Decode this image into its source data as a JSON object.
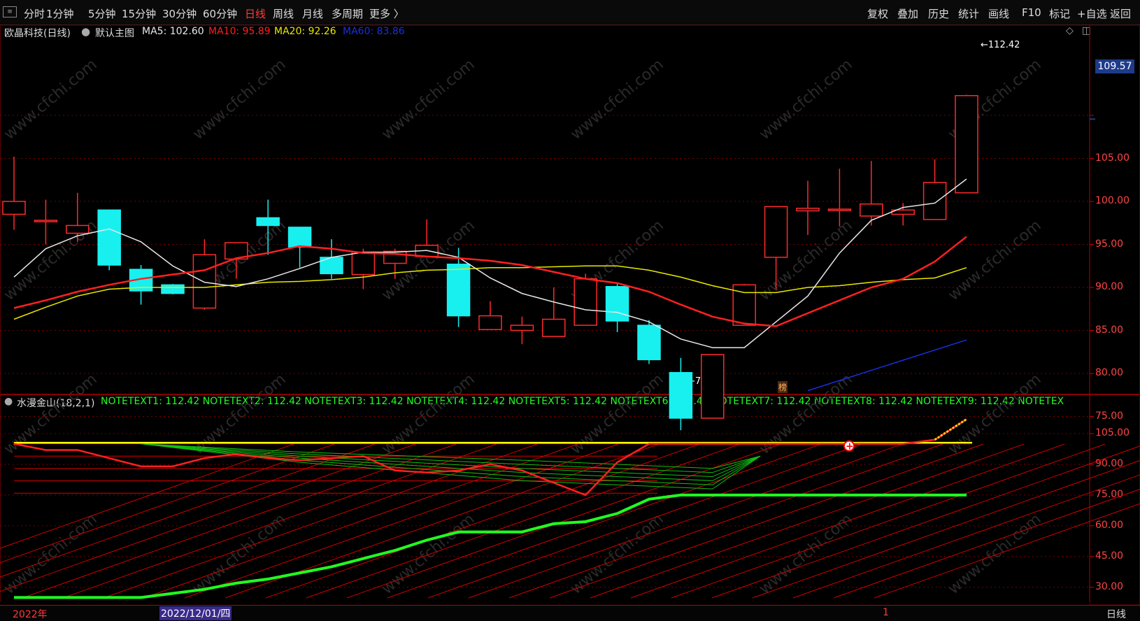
{
  "toolbar": {
    "periods": [
      "分时",
      "1分钟",
      "5分钟",
      "15分钟",
      "30分钟",
      "60分钟",
      "日线",
      "周线",
      "月线",
      "多周期",
      "更多 〉"
    ],
    "active_period": "日线",
    "right_buttons": [
      "复权",
      "叠加",
      "历史",
      "统计",
      "画线",
      "F10",
      "标记",
      "+自选",
      "返回"
    ]
  },
  "main_header": {
    "stock": "欧晶科技(日线)",
    "template": "默认主图",
    "ma5": "MA5: 102.60",
    "ma10": "MA10: 95.89",
    "ma20": "MA20: 92.26",
    "ma60": "MA60: 83.86"
  },
  "colors": {
    "ma5": "#e8e8e8",
    "ma10": "#ff2020",
    "ma20": "#e8e800",
    "ma60": "#1a2fe0",
    "up": "#ff2a2a",
    "down": "#18f0f0",
    "grid": "#7a0000",
    "green": "#20ff20"
  },
  "price_axis": {
    "labels": [
      "105.00",
      "100.00",
      "95.00",
      "90.00",
      "85.00",
      "80.00",
      "75.00"
    ],
    "current": "109.57"
  },
  "markers": {
    "high": "112.42",
    "low": "73.43",
    "bang": "榜"
  },
  "indicator_header": {
    "name": "水漫金山(18,2,1)",
    "notes": "NOTETEXT1: 112.42  NOTETEXT2: 112.42  NOTETEXT3: 112.42  NOTETEXT4: 112.42  NOTETEXT5: 112.42  NOTETEXT6: 112.42  NOTETEXT7: 112.42  NOTETEXT8: 112.42  NOTETEXT9: 112.42  NOTETEX"
  },
  "indicator_axis": {
    "labels": [
      "105.00",
      "90.00",
      "75.00",
      "60.00",
      "45.00",
      "30.00"
    ]
  },
  "bottom": {
    "year": "2022年",
    "date": "2022/12/01/四",
    "tick": "1",
    "period": "日线"
  },
  "watermark": "www.cfchi.com",
  "chart_data": {
    "type": "candlestick",
    "ylim": [
      72,
      114
    ],
    "candles": [
      {
        "o": 98.5,
        "h": 105.2,
        "l": 96.7,
        "c": 100.0
      },
      {
        "o": 97.8,
        "h": 100.2,
        "l": 95.0,
        "c": 97.8
      },
      {
        "o": 96.3,
        "h": 101.0,
        "l": 95.3,
        "c": 97.2
      },
      {
        "o": 99.0,
        "h": 99.0,
        "l": 92.0,
        "c": 92.6
      },
      {
        "o": 92.1,
        "h": 92.6,
        "l": 88.0,
        "c": 89.6
      },
      {
        "o": 90.3,
        "h": 90.4,
        "l": 89.2,
        "c": 89.3
      },
      {
        "o": 87.6,
        "h": 95.6,
        "l": 87.4,
        "c": 93.8
      },
      {
        "o": 93.3,
        "h": 95.0,
        "l": 91.0,
        "c": 95.2
      },
      {
        "o": 98.1,
        "h": 100.2,
        "l": 93.8,
        "c": 97.2
      },
      {
        "o": 97.0,
        "h": 97.0,
        "l": 92.3,
        "c": 94.7
      },
      {
        "o": 93.5,
        "h": 95.6,
        "l": 91.0,
        "c": 91.6
      },
      {
        "o": 91.5,
        "h": 94.5,
        "l": 89.8,
        "c": 94.1
      },
      {
        "o": 92.8,
        "h": 94.5,
        "l": 91.0,
        "c": 94.2
      },
      {
        "o": 93.6,
        "h": 97.9,
        "l": 93.6,
        "c": 94.9
      },
      {
        "o": 92.7,
        "h": 94.6,
        "l": 85.4,
        "c": 86.7
      },
      {
        "o": 85.1,
        "h": 88.4,
        "l": 85.1,
        "c": 86.7
      },
      {
        "o": 85.0,
        "h": 86.6,
        "l": 83.4,
        "c": 85.6
      },
      {
        "o": 84.3,
        "h": 90.0,
        "l": 84.3,
        "c": 86.3
      },
      {
        "o": 85.6,
        "h": 91.6,
        "l": 85.6,
        "c": 91.0
      },
      {
        "o": 90.1,
        "h": 90.4,
        "l": 84.8,
        "c": 86.1
      },
      {
        "o": 85.6,
        "h": 86.2,
        "l": 81.1,
        "c": 81.6
      },
      {
        "o": 80.1,
        "h": 81.8,
        "l": 73.4,
        "c": 74.8
      },
      {
        "o": 74.8,
        "h": 82.2,
        "l": 74.8,
        "c": 82.2
      },
      {
        "o": 85.6,
        "h": 90.4,
        "l": 85.6,
        "c": 90.3
      },
      {
        "o": 93.5,
        "h": 99.4,
        "l": 89.8,
        "c": 99.4
      },
      {
        "o": 98.9,
        "h": 102.4,
        "l": 96.1,
        "c": 99.2
      },
      {
        "o": 99.0,
        "h": 103.8,
        "l": 97.1,
        "c": 99.1
      },
      {
        "o": 98.3,
        "h": 104.7,
        "l": 97.2,
        "c": 99.7
      },
      {
        "o": 98.5,
        "h": 99.8,
        "l": 97.2,
        "c": 99.0
      },
      {
        "o": 97.9,
        "h": 104.9,
        "l": 97.9,
        "c": 102.2
      },
      {
        "o": 101.0,
        "h": 112.4,
        "l": 101.0,
        "c": 112.3
      }
    ],
    "ma5": [
      91.2,
      94.5,
      96.0,
      96.8,
      95.3,
      92.5,
      90.6,
      90.1,
      91.0,
      92.2,
      93.5,
      94.1,
      94.1,
      94.3,
      93.5,
      91.1,
      89.3,
      88.3,
      87.4,
      87.1,
      86.0,
      84.0,
      83.0,
      83.0,
      86.0,
      89.0,
      94.0,
      97.8,
      99.3,
      99.8,
      102.6
    ],
    "ma10": [
      87.6,
      88.5,
      89.5,
      90.3,
      91.0,
      91.5,
      92.0,
      93.4,
      94.0,
      94.8,
      94.5,
      94.0,
      93.9,
      93.6,
      93.4,
      93.1,
      92.6,
      91.8,
      91.0,
      90.5,
      89.5,
      88.0,
      86.6,
      85.8,
      85.5,
      87.0,
      88.5,
      90.0,
      91.0,
      93.0,
      95.9
    ],
    "ma20": [
      86.3,
      87.7,
      89.0,
      89.8,
      90.0,
      90.0,
      90.0,
      90.3,
      90.6,
      90.7,
      90.9,
      91.2,
      91.7,
      92.0,
      92.1,
      92.3,
      92.3,
      92.4,
      92.5,
      92.5,
      92.0,
      91.2,
      90.2,
      89.4,
      89.4,
      90.0,
      90.2,
      90.6,
      90.9,
      91.1,
      92.3
    ],
    "ma60_start": [
      25,
      78.0
    ],
    "ma60_end": [
      30,
      83.9
    ],
    "indicator_ylim": [
      24,
      117
    ],
    "indicator_green": [
      25,
      25,
      25,
      25,
      25,
      27,
      29,
      32,
      34,
      37,
      40,
      44,
      48,
      53,
      57,
      57,
      57,
      61,
      62,
      66,
      73,
      75,
      75,
      75,
      75,
      75,
      75,
      75,
      75,
      75,
      75
    ],
    "indicator_red": [
      100,
      97,
      97,
      93,
      89,
      89,
      93,
      95,
      93,
      92,
      93,
      94,
      87,
      86,
      87,
      90,
      87,
      81,
      75,
      91,
      100,
      100,
      100,
      100,
      100,
      100,
      100,
      100,
      100,
      102,
      112
    ]
  }
}
